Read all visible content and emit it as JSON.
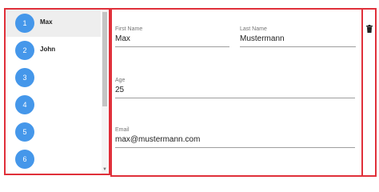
{
  "list": {
    "items": [
      {
        "number": "1",
        "name": "Max",
        "selected": true
      },
      {
        "number": "2",
        "name": "John",
        "selected": false
      },
      {
        "number": "3",
        "name": "",
        "selected": false
      },
      {
        "number": "4",
        "name": "",
        "selected": false
      },
      {
        "number": "5",
        "name": "",
        "selected": false
      },
      {
        "number": "6",
        "name": "",
        "selected": false
      }
    ]
  },
  "form": {
    "first_name": {
      "label": "First Name",
      "value": "Max"
    },
    "last_name": {
      "label": "Last Name",
      "value": "Mustermann"
    },
    "age": {
      "label": "Age",
      "value": "25"
    },
    "email": {
      "label": "Email",
      "value": "max@mustermann.com"
    }
  },
  "actions": {
    "delete_icon": "trash-icon"
  },
  "colors": {
    "avatar": "#4597ea",
    "frame": "#e0303a",
    "selected_row": "#eeeeee"
  }
}
